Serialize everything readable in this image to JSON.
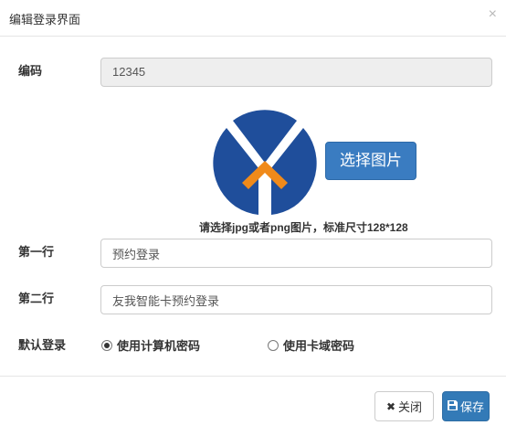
{
  "dialog": {
    "title": "编辑登录界面",
    "close_glyph": "×"
  },
  "form": {
    "code_label": "编码",
    "code_value": "12345",
    "upload_label": "选择图片",
    "upload_hint": "请选择jpg或者png图片，标准尺寸128*128",
    "line1_label": "第一行",
    "line1_value": "预约登录",
    "line2_label": "第二行",
    "line2_value": "友我智能卡预约登录",
    "default_login_label": "默认登录",
    "options": [
      {
        "label": "使用计算机密码",
        "checked": true
      },
      {
        "label": "使用卡域密码",
        "checked": false
      }
    ]
  },
  "footer": {
    "close_label": "关闭",
    "close_icon": "x-icon",
    "save_label": "保存",
    "save_icon": "save-icon"
  },
  "colors": {
    "logo_blue": "#1f4e9b",
    "logo_orange": "#f08a1a",
    "primary": "#337ab7",
    "upload_button": "#3a7cc1"
  }
}
